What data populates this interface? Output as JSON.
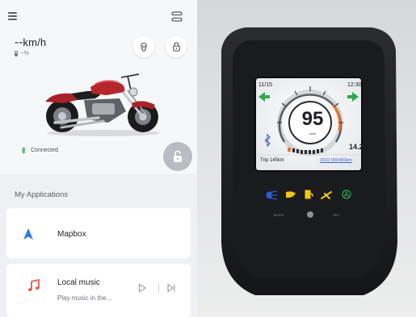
{
  "app": {
    "speed_value": "--",
    "speed_unit": "km/h",
    "battery_text": "--%",
    "connection_status": "Connected",
    "menu_icon": "hamburger-menu-icon",
    "switch_icon": "switch-view-icon",
    "helmet_icon": "helmet-icon",
    "lock_icon": "lock-icon",
    "unlock_icon": "unlock-icon",
    "bluetooth_icon": "bluetooth-icon",
    "vehicle_image": "red-cruiser-motorcycle"
  },
  "applications": {
    "section_title": "My Applications",
    "items": [
      {
        "label": "Mapbox",
        "icon": "navigation-arrow-icon",
        "icon_color": "#2d7be5"
      },
      {
        "label": "Local music",
        "subtitle": "Play music in the...",
        "icon": "music-note-icon",
        "icon_color": "#e85a4f",
        "controls": [
          "play-icon",
          "skip-next-icon"
        ]
      }
    ]
  },
  "dashboard": {
    "date": "11/15",
    "time": "12:30",
    "speed": "95",
    "speed_unit": "km/h",
    "temperature": "14.2",
    "trip": "Trip 145km",
    "odometer": "ODO 000400km",
    "left_button_label": "MODE",
    "right_button_label": "SEL",
    "indicator_icons": [
      "high-beam-icon",
      "low-beam-icon",
      "fuel-icon",
      "warning-icon",
      "abs-icon"
    ],
    "colors": {
      "turn_signal": "#2fa84f",
      "high_beam": "#2a5bd7",
      "warning": "#f3c316",
      "abs": "#2fa84f",
      "gauge_accent": "#e8742a"
    }
  }
}
